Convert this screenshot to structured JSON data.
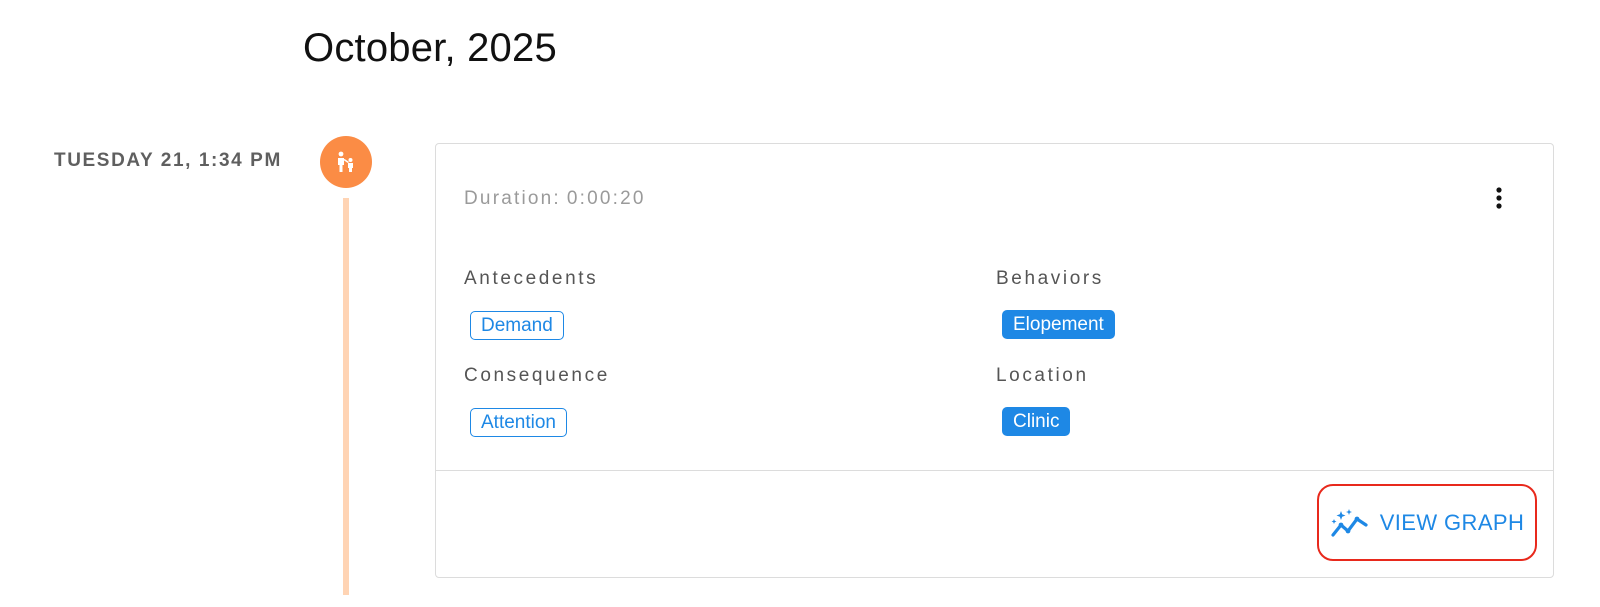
{
  "month_header": "October, 2025",
  "entry": {
    "timestamp": "TUESDAY 21, 1:34 PM",
    "icon": "parent-child-icon",
    "accent_color": "#fb8c45",
    "line_color": "#ffd4b4",
    "duration_label": "Duration:",
    "duration_value": "0:00:20",
    "more_icon": "more-vert-icon",
    "sections": {
      "antecedents": {
        "label": "Antecedents",
        "tags": [
          "Demand"
        ]
      },
      "behaviors": {
        "label": "Behaviors",
        "tags": [
          "Elopement"
        ]
      },
      "consequence": {
        "label": "Consequence",
        "tags": [
          "Attention"
        ]
      },
      "location": {
        "label": "Location",
        "tags": [
          "Clinic"
        ]
      }
    },
    "action": {
      "label": "VIEW GRAPH",
      "icon": "auto-graph-icon",
      "color": "#1e88e5",
      "highlight_color": "#e8291c"
    }
  }
}
